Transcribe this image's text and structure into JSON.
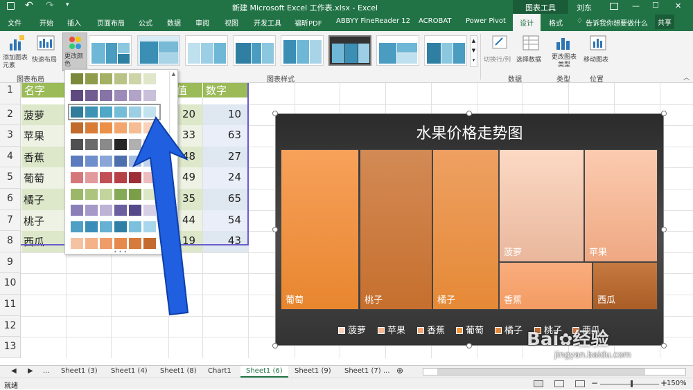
{
  "titlebar": {
    "doc_title": "新建 Microsoft Excel 工作表.xlsx - Excel",
    "context_tab": "图表工具",
    "user": "刘东",
    "min_btn": "—",
    "restore_btn": "☐",
    "close_btn": "✕",
    "save_icon": "save-icon"
  },
  "tabs": [
    "文件",
    "开始",
    "插入",
    "页面布局",
    "公式",
    "数据",
    "审阅",
    "视图",
    "开发工具",
    "福昕PDF",
    "ABBYY FineReader 12",
    "ACROBAT",
    "Power Pivot",
    "设计",
    "格式"
  ],
  "tell_me": "告诉我你想要做什么",
  "share": "共享",
  "ribbon": {
    "add_element": "添加图表元素",
    "quick_layout": "快速布局",
    "change_colors": "更改颜色",
    "group_layout": "图表布局",
    "group_styles": "图表样式",
    "switch_row_col": "切换行/列",
    "select_data": "选择数据",
    "group_data": "数据",
    "change_type": "更改图表类型",
    "group_type": "类型",
    "move_chart": "移动图表",
    "group_location": "位置"
  },
  "sheet": {
    "row_numbers": [
      "1",
      "2",
      "3",
      "4",
      "5",
      "6",
      "7",
      "8",
      "9",
      "10",
      "11",
      "12",
      "13"
    ],
    "header_a": "名字",
    "header_c": "值",
    "header_d": "数字",
    "names": [
      "菠萝",
      "苹果",
      "香蕉",
      "葡萄",
      "橘子",
      "桃子",
      "西瓜"
    ],
    "col_c": [
      "20",
      "33",
      "48",
      "49",
      "35",
      "44",
      "19"
    ],
    "col_d": [
      "10",
      "63",
      "27",
      "24",
      "65",
      "54",
      "43"
    ]
  },
  "chart_data": {
    "type": "treemap",
    "title": "水果价格走势图",
    "categories": [
      "葡萄",
      "桃子",
      "橘子",
      "菠萝",
      "苹果",
      "香蕉",
      "西瓜"
    ],
    "legend": [
      "菠萝",
      "苹果",
      "香蕉",
      "葡萄",
      "橘子",
      "桃子",
      "西瓜"
    ],
    "legend_position": "bottom"
  },
  "sheet_tabs": [
    "...",
    "Sheet1 (3)",
    "Sheet1 (4)",
    "Sheet1 (8)",
    "Chart1",
    "Sheet1 (6)",
    "Sheet1 (9)",
    "Sheet1 (7)",
    "..."
  ],
  "active_sheet": "Sheet1 (6)",
  "status": {
    "ready": "就绪",
    "zoom": "150%"
  },
  "watermark": {
    "brand": "Bai",
    "brand2": "经验",
    "url": "jingyan.baidu.com"
  },
  "colors": {
    "excel_green": "#217346",
    "arrow_blue": "#1f5fe0"
  }
}
